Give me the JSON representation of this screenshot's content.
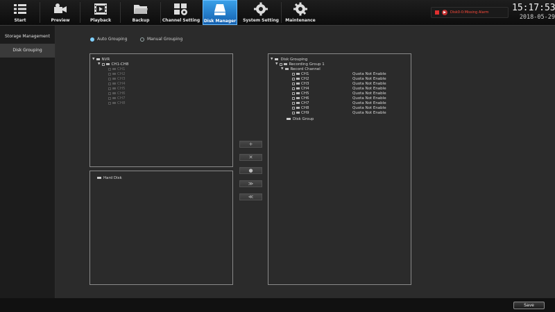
{
  "nav": [
    {
      "label": "Start",
      "icon": "start-grid-icon"
    },
    {
      "label": "Preview",
      "icon": "preview-icon"
    },
    {
      "label": "Playback",
      "icon": "playback-film-icon"
    },
    {
      "label": "Backup",
      "icon": "backup-folder-icon"
    },
    {
      "label": "Channel Setting",
      "icon": "channel-setting-icon"
    },
    {
      "label": "Disk Manager",
      "icon": "disk-manager-icon",
      "active": true
    },
    {
      "label": "System Setting",
      "icon": "system-setting-icon"
    },
    {
      "label": "Maintenance",
      "icon": "maintenance-gear-icon"
    }
  ],
  "alarm": {
    "text": "Disk0-0:Missing Alarm"
  },
  "clock": {
    "time": "15:17:53",
    "date": "2018-05-29"
  },
  "sidebar": {
    "items": [
      {
        "label": "Storage Management"
      },
      {
        "label": "Disk Grouping",
        "selected": true
      }
    ]
  },
  "grouping_mode": {
    "auto": "Auto Grouping",
    "manual": "Manual Grouping",
    "selected": "auto"
  },
  "channel_tree": {
    "root": "NVR",
    "group": "CH1-CH8",
    "channels": [
      "CH1",
      "CH2",
      "CH3",
      "CH4",
      "CH5",
      "CH6",
      "CH7",
      "CH8"
    ]
  },
  "hard_disk_panel": {
    "root": "Hard Disk"
  },
  "disk_grouping_tree": {
    "root": "Disk Grouping",
    "group": "Recording Group 1",
    "record_channel": "Record Channel",
    "channels": [
      {
        "name": "CH1",
        "quota": "Quota Not Enable"
      },
      {
        "name": "CH2",
        "quota": "Quota Not Enable"
      },
      {
        "name": "CH3",
        "quota": "Quota Not Enable"
      },
      {
        "name": "CH4",
        "quota": "Quota Not Enable"
      },
      {
        "name": "CH5",
        "quota": "Quota Not Enable"
      },
      {
        "name": "CH6",
        "quota": "Quota Not Enable"
      },
      {
        "name": "CH7",
        "quota": "Quota Not Enable"
      },
      {
        "name": "CH8",
        "quota": "Quota Not Enable"
      },
      {
        "name": "CH9",
        "quota": "Quota Not Enable"
      }
    ],
    "disk_group": "Disk Group"
  },
  "actions": {
    "add": "+",
    "delete": "✕",
    "config": "●",
    "move_right": "≫",
    "move_left": "≪"
  },
  "footer": {
    "save_label": "Save"
  },
  "colors": {
    "active_tab": "#1f7fd6",
    "alarm_text": "#ff4a3a",
    "panel_border": "#8a8a8a"
  }
}
